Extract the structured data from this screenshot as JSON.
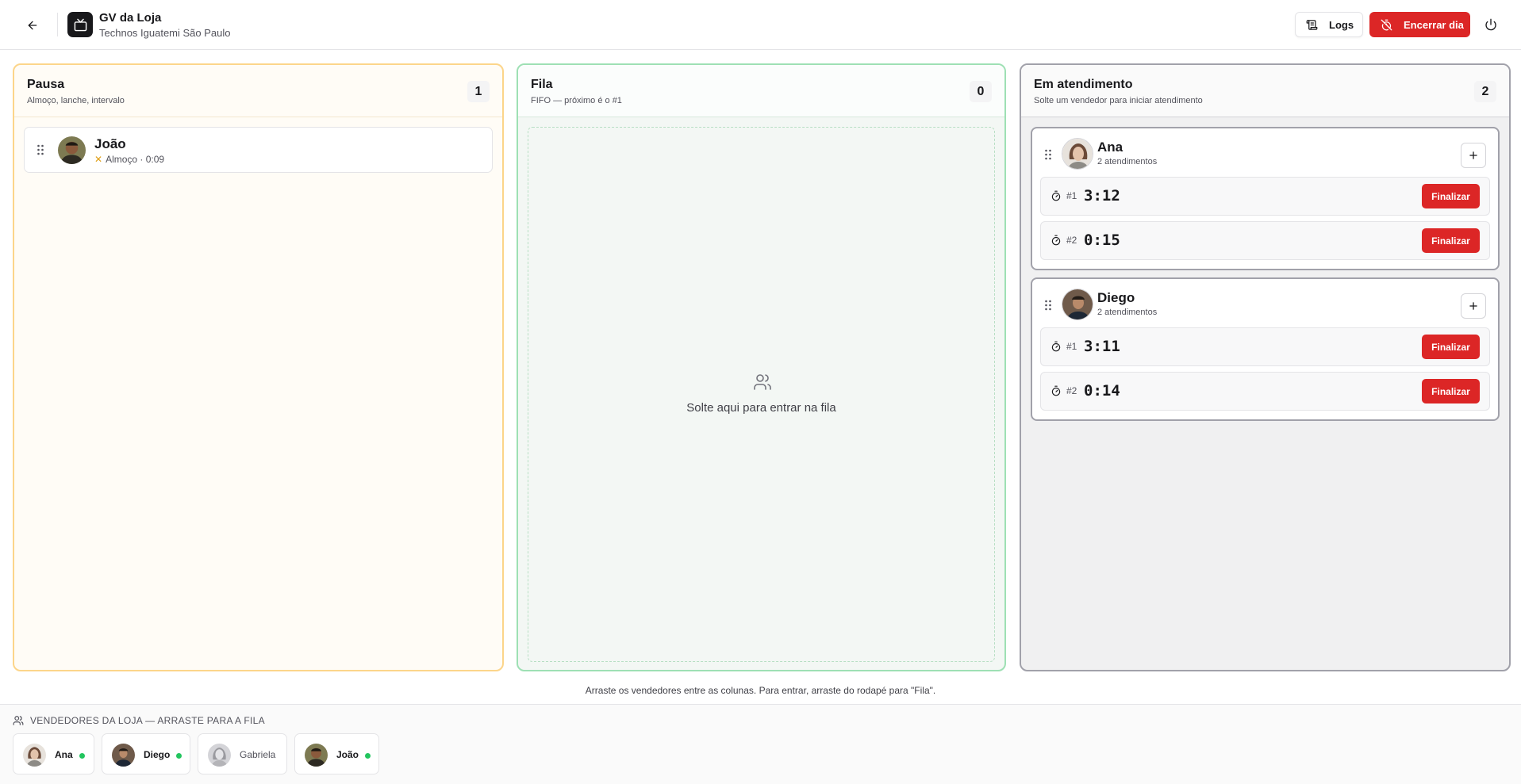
{
  "header": {
    "title": "GV da Loja",
    "subtitle": "Technos Iguatemi São Paulo",
    "logs_label": "Logs",
    "end_day_label": "Encerrar dia"
  },
  "columns": {
    "pause": {
      "title": "Pausa",
      "subtitle": "Almoço, lanche, intervalo",
      "count": "1",
      "items": [
        {
          "name": "João",
          "status": "Almoço · 0:09"
        }
      ]
    },
    "queue": {
      "title": "Fila",
      "subtitle": "FIFO — próximo é o #1",
      "count": "0",
      "empty_text": "Solte aqui para entrar na fila"
    },
    "serving": {
      "title": "Em atendimento",
      "subtitle": "Solte um vendedor para iniciar atendimento",
      "count": "2",
      "vendors": [
        {
          "name": "Ana",
          "count_label": "2 atendimentos",
          "sessions": [
            {
              "num": "#1",
              "time": "3:12",
              "action": "Finalizar"
            },
            {
              "num": "#2",
              "time": "0:15",
              "action": "Finalizar"
            }
          ]
        },
        {
          "name": "Diego",
          "count_label": "2 atendimentos",
          "sessions": [
            {
              "num": "#1",
              "time": "3:11",
              "action": "Finalizar"
            },
            {
              "num": "#2",
              "time": "0:14",
              "action": "Finalizar"
            }
          ]
        }
      ]
    }
  },
  "hint": "Arraste os vendedores entre as colunas. Para entrar, arraste do rodapé para \"Fila\".",
  "footer": {
    "title": "VENDEDORES DA LOJA — ARRASTE PARA A FILA",
    "sellers": [
      {
        "name": "Ana",
        "online": true
      },
      {
        "name": "Diego",
        "online": true
      },
      {
        "name": "Gabriela",
        "online": false
      },
      {
        "name": "João",
        "online": true
      }
    ]
  },
  "colors": {
    "accent_red": "#dc2626",
    "pause_border": "#fcd58a",
    "queue_border": "#9ee0b4",
    "serving_border": "#a1a1aa",
    "online_dot": "#22c55e"
  },
  "icons": [
    "arrow-left-icon",
    "tv-icon",
    "scroll-icon",
    "timer-off-icon",
    "power-icon",
    "grip-icon",
    "sandwich-icon",
    "users-icon",
    "timer-icon",
    "plus-icon"
  ]
}
